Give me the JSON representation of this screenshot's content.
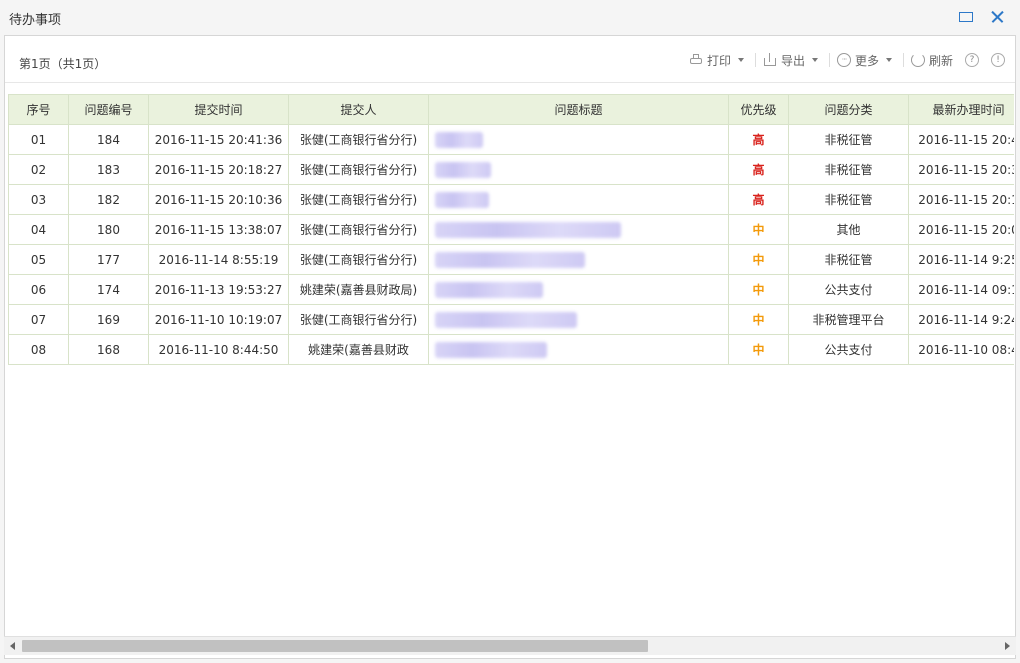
{
  "window": {
    "title": "待办事项"
  },
  "toolbar": {
    "page_info": "第1页（共1页）",
    "print_label": "打印",
    "export_label": "导出",
    "more_label": "更多",
    "refresh_label": "刷新",
    "help_glyph": "?",
    "info_glyph": "!"
  },
  "table": {
    "headers": [
      "序号",
      "问题编号",
      "提交时间",
      "提交人",
      "问题标题",
      "优先级",
      "问题分类",
      "最新办理时间"
    ],
    "rows": [
      {
        "seq": "01",
        "id": "184",
        "time": "2016-11-15 20:41:36",
        "submitter": "张健(工商银行省分行)",
        "priority": "高",
        "category": "非税征管",
        "latest": "2016-11-15 20:4"
      },
      {
        "seq": "02",
        "id": "183",
        "time": "2016-11-15 20:18:27",
        "submitter": "张健(工商银行省分行)",
        "priority": "高",
        "category": "非税征管",
        "latest": "2016-11-15 20:3"
      },
      {
        "seq": "03",
        "id": "182",
        "time": "2016-11-15 20:10:36",
        "submitter": "张健(工商银行省分行)",
        "priority": "高",
        "category": "非税征管",
        "latest": "2016-11-15 20:1"
      },
      {
        "seq": "04",
        "id": "180",
        "time": "2016-11-15 13:38:07",
        "submitter": "张健(工商银行省分行)",
        "priority": "中",
        "category": "其他",
        "latest": "2016-11-15 20:0"
      },
      {
        "seq": "05",
        "id": "177",
        "time": "2016-11-14 8:55:19",
        "submitter": "张健(工商银行省分行)",
        "priority": "中",
        "category": "非税征管",
        "latest": "2016-11-14 9:25"
      },
      {
        "seq": "06",
        "id": "174",
        "time": "2016-11-13 19:53:27",
        "submitter": "姚建荣(嘉善县财政局)",
        "priority": "中",
        "category": "公共支付",
        "latest": "2016-11-14 09:1"
      },
      {
        "seq": "07",
        "id": "169",
        "time": "2016-11-10 10:19:07",
        "submitter": "张健(工商银行省分行)",
        "priority": "中",
        "category": "非税管理平台",
        "latest": "2016-11-14 9:24"
      },
      {
        "seq": "08",
        "id": "168",
        "time": "2016-11-10 8:44:50",
        "submitter": "姚建荣(嘉善县财政",
        "priority": "中",
        "category": "公共支付",
        "latest": "2016-11-10 08:4"
      }
    ]
  },
  "colors": {
    "header_bg": "#eaf2dd",
    "priority_high": "#d9221c",
    "priority_mid": "#f39a0a",
    "accent": "#2d78c8"
  }
}
